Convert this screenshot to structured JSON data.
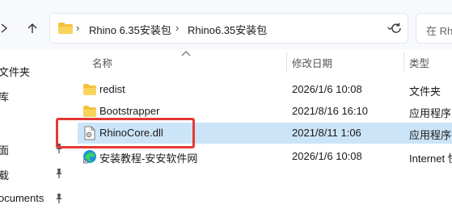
{
  "addressbar": {
    "crumbs": [
      {
        "label": "Rhino 6.35安装包"
      },
      {
        "label": "Rhino6.35安装包"
      }
    ],
    "separator": "›",
    "dropdown_glyph": "⌄"
  },
  "search": {
    "placeholder": "在 Rhino"
  },
  "sidebar": {
    "items": [
      {
        "label": "文件夹",
        "pinned": false
      },
      {
        "label": "库",
        "pinned": false
      },
      {
        "label": "面",
        "pinned": true
      },
      {
        "label": "载",
        "pinned": true
      },
      {
        "label": "ocuments",
        "pinned": true
      }
    ]
  },
  "columns": {
    "name": "名称",
    "date": "修改日期",
    "type": "类型"
  },
  "files": [
    {
      "icon": "folder-icon",
      "name": "redist",
      "date": "2026/1/6 10:08",
      "type": "文件夹"
    },
    {
      "icon": "folder-icon",
      "name": "Bootstrapper",
      "date": "2021/8/16 16:10",
      "type": "应用程序"
    },
    {
      "icon": "dll-file-icon",
      "name": "RhinoCore.dll",
      "date": "2021/8/11 1:06",
      "type": "应用程序扩",
      "selected": true
    },
    {
      "icon": "edge-shortcut-icon",
      "name": "安装教程-安安软件网",
      "date": "2026/1/6 10:08",
      "type": "Internet 快"
    }
  ],
  "colors": {
    "selection": "#cce4f7",
    "highlight_box": "#e53935",
    "folder": "#f4c13d"
  }
}
